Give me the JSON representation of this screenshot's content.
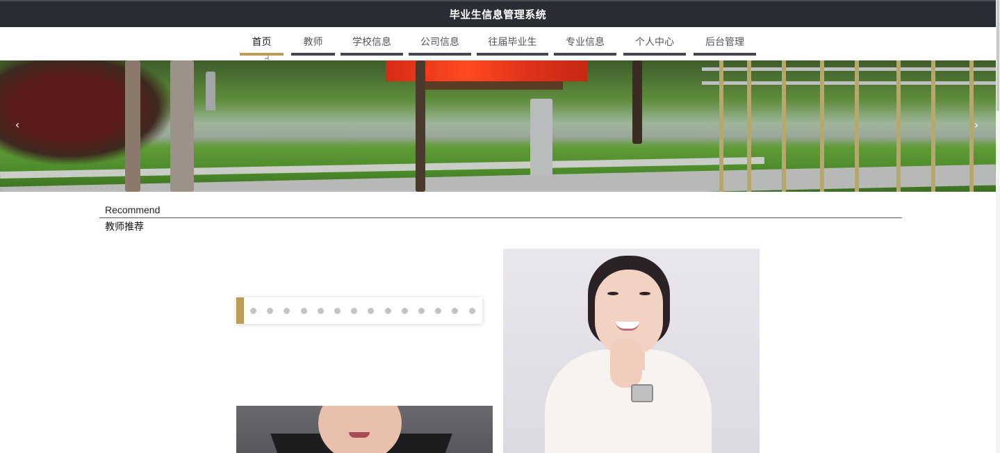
{
  "header": {
    "title": "毕业生信息管理系统"
  },
  "nav": {
    "items": [
      {
        "label": "首页",
        "active": true
      },
      {
        "label": "教师",
        "active": false
      },
      {
        "label": "学校信息",
        "active": false
      },
      {
        "label": "公司信息",
        "active": false
      },
      {
        "label": "往届毕业生",
        "active": false
      },
      {
        "label": "专业信息",
        "active": false
      },
      {
        "label": "个人中心",
        "active": false
      },
      {
        "label": "后台管理",
        "active": false
      }
    ]
  },
  "banner": {
    "prev_icon": "chevron-left-icon",
    "next_icon": "chevron-right-icon",
    "prev_glyph": "‹",
    "next_glyph": "›"
  },
  "recommend": {
    "title_en": "Recommend",
    "title_cn": "教师推荐",
    "carousel_dot_count": 14
  },
  "colors": {
    "accent": "#bb9d55",
    "header_bg": "#2b2d35",
    "nav_underline": "#45474d"
  }
}
